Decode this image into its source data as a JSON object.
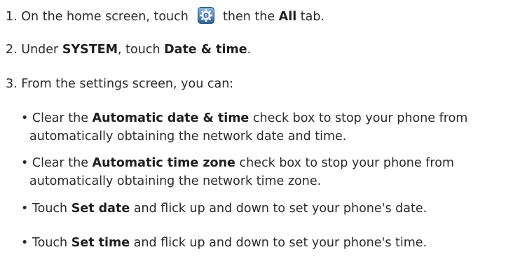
{
  "steps": [
    {
      "number": "1.",
      "text_a": "On the home screen, touch",
      "icon": "settings-gear-icon",
      "text_b": "then the",
      "bold_a": "All",
      "text_c": "tab."
    },
    {
      "number": "2.",
      "text_a": "Under",
      "bold_a": "SYSTEM",
      "text_b": ", touch",
      "bold_b": "Date & time",
      "text_c": "."
    },
    {
      "number": "3.",
      "text_a": "From the settings screen, you can:"
    }
  ],
  "bullets": [
    {
      "marker": "•",
      "text_a": "Clear the",
      "bold_a": "Automatic date & time",
      "text_b": "check box to stop your phone from",
      "continuation": "automatically obtaining the network date and time."
    },
    {
      "marker": "•",
      "text_a": "Clear the",
      "bold_a": "Automatic time zone",
      "text_b": "check box to stop your phone from",
      "continuation": "automatically obtaining the network time zone."
    },
    {
      "marker": "•",
      "text_a": "Touch",
      "bold_a": "Set date",
      "text_b": "and flick up and down to set your phone's date."
    },
    {
      "marker": "•",
      "text_a": "Touch",
      "bold_a": "Set time",
      "text_b": "and flick up and down to set your phone's time."
    }
  ],
  "colors": {
    "text": "#2b2b2b",
    "icon_gradient_top": "#8fb8de",
    "icon_gradient_bottom": "#2f5f93"
  }
}
